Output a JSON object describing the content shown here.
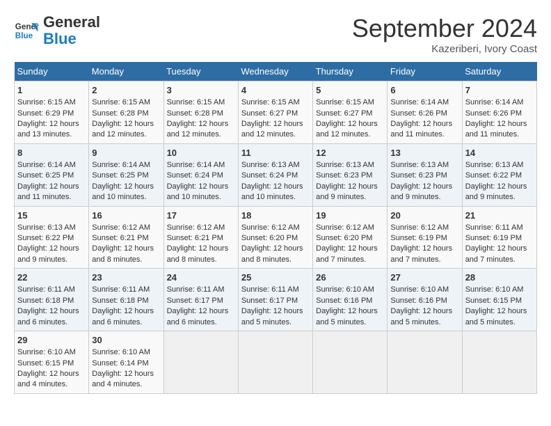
{
  "logo": {
    "line1": "General",
    "line2": "Blue"
  },
  "title": "September 2024",
  "subtitle": "Kazeriberi, Ivory Coast",
  "days_of_week": [
    "Sunday",
    "Monday",
    "Tuesday",
    "Wednesday",
    "Thursday",
    "Friday",
    "Saturday"
  ],
  "weeks": [
    [
      {
        "day": "1",
        "info": "Sunrise: 6:15 AM\nSunset: 6:29 PM\nDaylight: 12 hours\nand 13 minutes."
      },
      {
        "day": "2",
        "info": "Sunrise: 6:15 AM\nSunset: 6:28 PM\nDaylight: 12 hours\nand 12 minutes."
      },
      {
        "day": "3",
        "info": "Sunrise: 6:15 AM\nSunset: 6:28 PM\nDaylight: 12 hours\nand 12 minutes."
      },
      {
        "day": "4",
        "info": "Sunrise: 6:15 AM\nSunset: 6:27 PM\nDaylight: 12 hours\nand 12 minutes."
      },
      {
        "day": "5",
        "info": "Sunrise: 6:15 AM\nSunset: 6:27 PM\nDaylight: 12 hours\nand 12 minutes."
      },
      {
        "day": "6",
        "info": "Sunrise: 6:14 AM\nSunset: 6:26 PM\nDaylight: 12 hours\nand 11 minutes."
      },
      {
        "day": "7",
        "info": "Sunrise: 6:14 AM\nSunset: 6:26 PM\nDaylight: 12 hours\nand 11 minutes."
      }
    ],
    [
      {
        "day": "8",
        "info": "Sunrise: 6:14 AM\nSunset: 6:25 PM\nDaylight: 12 hours\nand 11 minutes."
      },
      {
        "day": "9",
        "info": "Sunrise: 6:14 AM\nSunset: 6:25 PM\nDaylight: 12 hours\nand 10 minutes."
      },
      {
        "day": "10",
        "info": "Sunrise: 6:14 AM\nSunset: 6:24 PM\nDaylight: 12 hours\nand 10 minutes."
      },
      {
        "day": "11",
        "info": "Sunrise: 6:13 AM\nSunset: 6:24 PM\nDaylight: 12 hours\nand 10 minutes."
      },
      {
        "day": "12",
        "info": "Sunrise: 6:13 AM\nSunset: 6:23 PM\nDaylight: 12 hours\nand 9 minutes."
      },
      {
        "day": "13",
        "info": "Sunrise: 6:13 AM\nSunset: 6:23 PM\nDaylight: 12 hours\nand 9 minutes."
      },
      {
        "day": "14",
        "info": "Sunrise: 6:13 AM\nSunset: 6:22 PM\nDaylight: 12 hours\nand 9 minutes."
      }
    ],
    [
      {
        "day": "15",
        "info": "Sunrise: 6:13 AM\nSunset: 6:22 PM\nDaylight: 12 hours\nand 9 minutes."
      },
      {
        "day": "16",
        "info": "Sunrise: 6:12 AM\nSunset: 6:21 PM\nDaylight: 12 hours\nand 8 minutes."
      },
      {
        "day": "17",
        "info": "Sunrise: 6:12 AM\nSunset: 6:21 PM\nDaylight: 12 hours\nand 8 minutes."
      },
      {
        "day": "18",
        "info": "Sunrise: 6:12 AM\nSunset: 6:20 PM\nDaylight: 12 hours\nand 8 minutes."
      },
      {
        "day": "19",
        "info": "Sunrise: 6:12 AM\nSunset: 6:20 PM\nDaylight: 12 hours\nand 7 minutes."
      },
      {
        "day": "20",
        "info": "Sunrise: 6:12 AM\nSunset: 6:19 PM\nDaylight: 12 hours\nand 7 minutes."
      },
      {
        "day": "21",
        "info": "Sunrise: 6:11 AM\nSunset: 6:19 PM\nDaylight: 12 hours\nand 7 minutes."
      }
    ],
    [
      {
        "day": "22",
        "info": "Sunrise: 6:11 AM\nSunset: 6:18 PM\nDaylight: 12 hours\nand 6 minutes."
      },
      {
        "day": "23",
        "info": "Sunrise: 6:11 AM\nSunset: 6:18 PM\nDaylight: 12 hours\nand 6 minutes."
      },
      {
        "day": "24",
        "info": "Sunrise: 6:11 AM\nSunset: 6:17 PM\nDaylight: 12 hours\nand 6 minutes."
      },
      {
        "day": "25",
        "info": "Sunrise: 6:11 AM\nSunset: 6:17 PM\nDaylight: 12 hours\nand 5 minutes."
      },
      {
        "day": "26",
        "info": "Sunrise: 6:10 AM\nSunset: 6:16 PM\nDaylight: 12 hours\nand 5 minutes."
      },
      {
        "day": "27",
        "info": "Sunrise: 6:10 AM\nSunset: 6:16 PM\nDaylight: 12 hours\nand 5 minutes."
      },
      {
        "day": "28",
        "info": "Sunrise: 6:10 AM\nSunset: 6:15 PM\nDaylight: 12 hours\nand 5 minutes."
      }
    ],
    [
      {
        "day": "29",
        "info": "Sunrise: 6:10 AM\nSunset: 6:15 PM\nDaylight: 12 hours\nand 4 minutes."
      },
      {
        "day": "30",
        "info": "Sunrise: 6:10 AM\nSunset: 6:14 PM\nDaylight: 12 hours\nand 4 minutes."
      },
      {
        "day": "",
        "info": ""
      },
      {
        "day": "",
        "info": ""
      },
      {
        "day": "",
        "info": ""
      },
      {
        "day": "",
        "info": ""
      },
      {
        "day": "",
        "info": ""
      }
    ]
  ]
}
